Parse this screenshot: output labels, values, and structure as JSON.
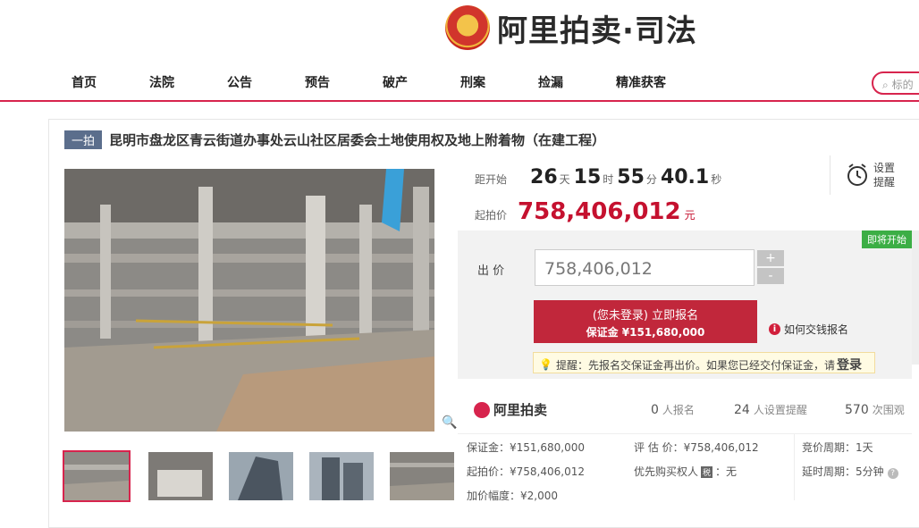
{
  "header": {
    "logo_text": "阿里拍卖·司法",
    "emblem": "court-emblem"
  },
  "nav": {
    "items": [
      "首页",
      "法院",
      "公告",
      "预告",
      "破产",
      "刑案",
      "捡漏",
      "精准获客"
    ],
    "search_placeholder": "标的"
  },
  "lot": {
    "badge": "一拍",
    "title": "昆明市盘龙区青云街道办事处云山社区居委会土地使用权及地上附着物（在建工程）"
  },
  "countdown": {
    "label": "距开始",
    "days": "26",
    "days_unit": "天",
    "hours": "15",
    "hours_unit": "时",
    "minutes": "55",
    "minutes_unit": "分",
    "seconds": "40.1",
    "seconds_unit": "秒"
  },
  "reminder": {
    "line1": "设置",
    "line2": "提醒",
    "icon": "alarm-clock-icon"
  },
  "start_price": {
    "label": "起拍价",
    "value": "758,406,012",
    "unit": "元"
  },
  "bid": {
    "soon_badge": "即将开始",
    "label": "出  价",
    "value": "758,406,012",
    "plus": "+",
    "minus": "-",
    "signup_line1": "(您未登录) 立即报名",
    "signup_line2": "保证金 ¥151,680,000",
    "how_pay": "如何交钱报名",
    "tip_prefix": "提醒：先报名交保证金再出价。如果您已经交付保证金，请",
    "tip_login": "登录"
  },
  "stats": {
    "brand": "阿里拍卖",
    "signups": "0",
    "signups_label": "人报名",
    "reminders": "24",
    "reminders_label": "人设置提醒",
    "views": "570",
    "views_label": "次围观"
  },
  "details": {
    "deposit": "保证金：¥151,680,000",
    "start": "起拍价：¥758,406,012",
    "increment": "加价幅度：¥2,000",
    "appraisal": "评 估 价：¥758,406,012",
    "priority_prefix": "优先购买权人",
    "priority_tax": "税",
    "priority_value": "：无",
    "cycle": "竞价周期：1天",
    "delay": "延时周期：5分钟"
  },
  "colors": {
    "accent": "#d7244d",
    "price": "#c5112f",
    "signup": "#c1273b",
    "soon": "#3cae45"
  }
}
